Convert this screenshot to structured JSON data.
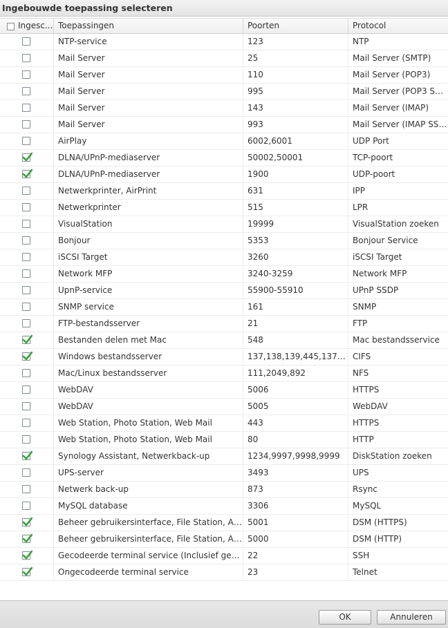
{
  "dialog": {
    "title": "Ingebouwde toepassing selecteren",
    "columns": [
      "Ingesc...",
      "Toepassingen",
      "Poorten",
      "Protocol"
    ],
    "ok_label": "OK",
    "cancel_label": "Annuleren"
  },
  "rows": [
    {
      "checked": false,
      "app": "NTP-service",
      "ports": "123",
      "protocol": "NTP"
    },
    {
      "checked": false,
      "app": "Mail Server",
      "ports": "25",
      "protocol": "Mail Server (SMTP)"
    },
    {
      "checked": false,
      "app": "Mail Server",
      "ports": "110",
      "protocol": "Mail Server (POP3)"
    },
    {
      "checked": false,
      "app": "Mail Server",
      "ports": "995",
      "protocol": "Mail Server (POP3 SSL..."
    },
    {
      "checked": false,
      "app": "Mail Server",
      "ports": "143",
      "protocol": "Mail Server (IMAP)"
    },
    {
      "checked": false,
      "app": "Mail Server",
      "ports": "993",
      "protocol": "Mail Server (IMAP SSL..."
    },
    {
      "checked": false,
      "app": "AirPlay",
      "ports": "6002,6001",
      "protocol": "UDP Port"
    },
    {
      "checked": true,
      "app": "DLNA/UPnP-mediaserver",
      "ports": "50002,50001",
      "protocol": "TCP-poort"
    },
    {
      "checked": true,
      "app": "DLNA/UPnP-mediaserver",
      "ports": "1900",
      "protocol": "UDP-poort"
    },
    {
      "checked": false,
      "app": "Netwerkprinter, AirPrint",
      "ports": "631",
      "protocol": "IPP"
    },
    {
      "checked": false,
      "app": "Netwerkprinter",
      "ports": "515",
      "protocol": "LPR"
    },
    {
      "checked": false,
      "app": "VisualStation",
      "ports": "19999",
      "protocol": "VisualStation zoeken"
    },
    {
      "checked": false,
      "app": "Bonjour",
      "ports": "5353",
      "protocol": "Bonjour Service"
    },
    {
      "checked": false,
      "app": "iSCSI Target",
      "ports": "3260",
      "protocol": "iSCSI Target"
    },
    {
      "checked": false,
      "app": "Network MFP",
      "ports": "3240-3259",
      "protocol": "Network MFP"
    },
    {
      "checked": false,
      "app": "UpnP-service",
      "ports": "55900-55910",
      "protocol": "UPnP SSDP"
    },
    {
      "checked": false,
      "app": "SNMP service",
      "ports": "161",
      "protocol": "SNMP"
    },
    {
      "checked": false,
      "app": "FTP-bestandsserver",
      "ports": "21",
      "protocol": "FTP"
    },
    {
      "checked": true,
      "app": "Bestanden delen met Mac",
      "ports": "548",
      "protocol": "Mac bestandsservice"
    },
    {
      "checked": true,
      "app": "Windows bestandsserver",
      "ports": "137,138,139,445,137 (...",
      "protocol": "CIFS"
    },
    {
      "checked": false,
      "app": "Mac/Linux bestandsserver",
      "ports": "111,2049,892",
      "protocol": "NFS"
    },
    {
      "checked": false,
      "app": "WebDAV",
      "ports": "5006",
      "protocol": "HTTPS"
    },
    {
      "checked": false,
      "app": "WebDAV",
      "ports": "5005",
      "protocol": "WebDAV"
    },
    {
      "checked": false,
      "app": "Web Station, Photo Station, Web Mail",
      "ports": "443",
      "protocol": "HTTPS"
    },
    {
      "checked": false,
      "app": "Web Station, Photo Station, Web Mail",
      "ports": "80",
      "protocol": "HTTP"
    },
    {
      "checked": true,
      "app": "Synology Assistant, Netwerkback-up",
      "ports": "1234,9997,9998,9999",
      "protocol": "DiskStation zoeken"
    },
    {
      "checked": false,
      "app": "UPS-server",
      "ports": "3493",
      "protocol": "UPS"
    },
    {
      "checked": false,
      "app": "Netwerk back-up",
      "ports": "873",
      "protocol": "Rsync"
    },
    {
      "checked": false,
      "app": "MySQL database",
      "ports": "3306",
      "protocol": "MySQL"
    },
    {
      "checked": true,
      "app": "Beheer gebruikersinterface, File Station, Au...",
      "ports": "5001",
      "protocol": "DSM (HTTPS)"
    },
    {
      "checked": true,
      "app": "Beheer gebruikersinterface, File Station, Au...",
      "ports": "5000",
      "protocol": "DSM (HTTP)"
    },
    {
      "checked": true,
      "app": "Gecodeerde terminal service (Inclusief geco...",
      "ports": "22",
      "protocol": "SSH"
    },
    {
      "checked": true,
      "app": "Ongecodeerde terminal service",
      "ports": "23",
      "protocol": "Telnet"
    }
  ],
  "colors": {
    "check": "#3aa33a",
    "checkbox_border": "#7f8a96"
  }
}
